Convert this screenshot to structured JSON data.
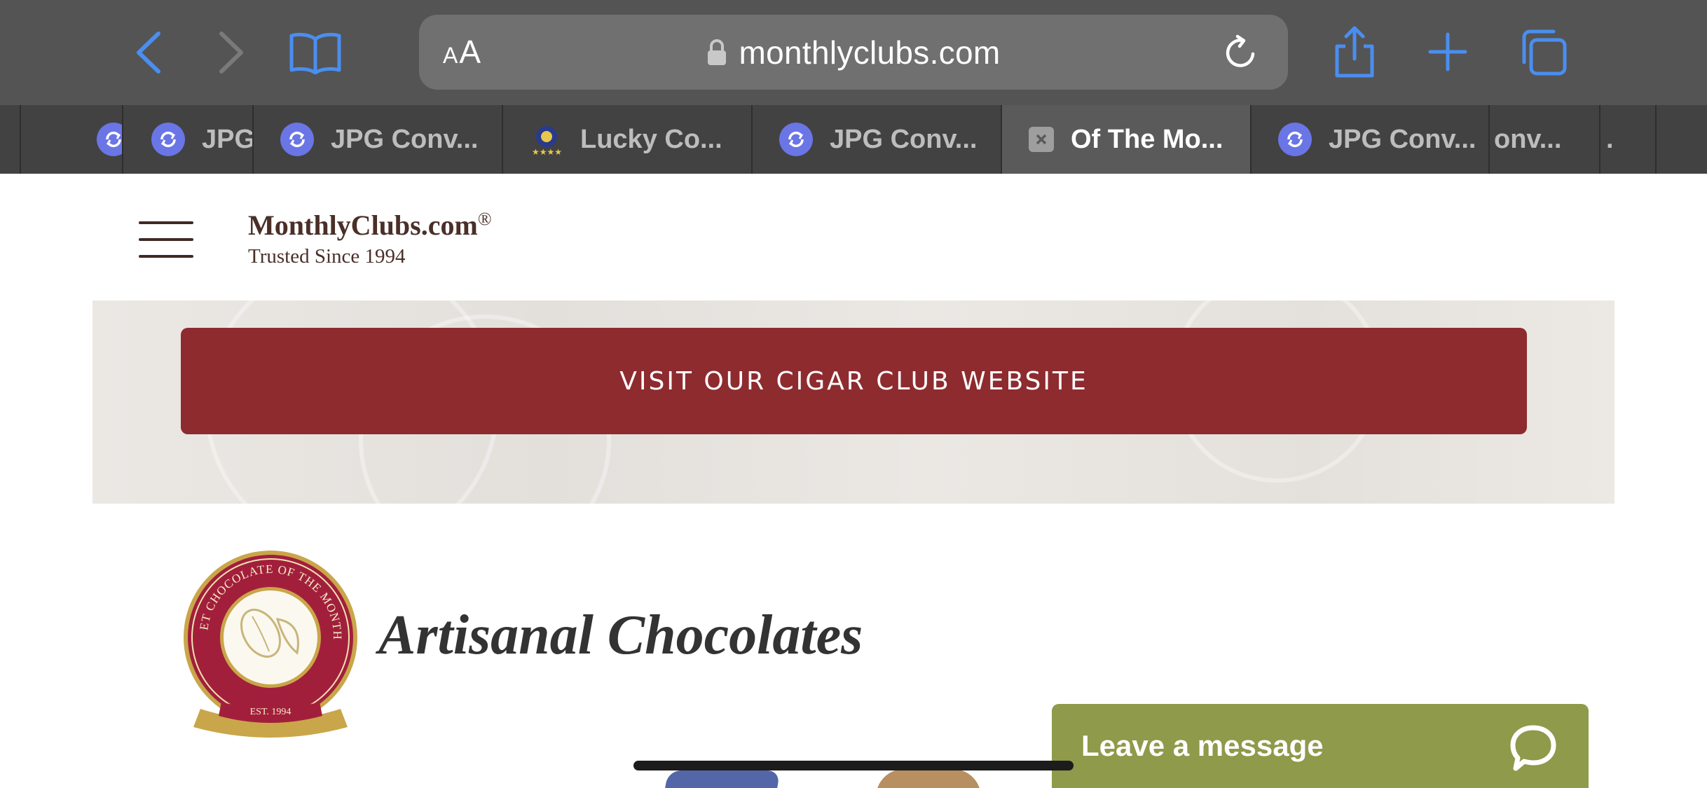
{
  "browser": {
    "url": "monthlyclubs.com",
    "aa_small": "A",
    "aa_big": "A",
    "tabs": [
      {
        "title": ""
      },
      {
        "title": "JPG"
      },
      {
        "title": "JPG Conv..."
      },
      {
        "title": "Lucky Co..."
      },
      {
        "title": "JPG Conv..."
      },
      {
        "title": "Of The Mo..."
      },
      {
        "title": "JPG Conv..."
      },
      {
        "title": "onv..."
      },
      {
        "title": "."
      }
    ],
    "icons": {
      "back": "chevron-left-icon",
      "forward": "chevron-right-icon",
      "bookmarks": "book-icon",
      "lock": "lock-icon",
      "reload": "reload-icon",
      "share": "share-icon",
      "new_tab": "plus-icon",
      "tabs": "tabs-icon"
    },
    "accent_color": "#4a8ef0"
  },
  "site": {
    "logo_title": "MonthlyClubs.com",
    "logo_reg": "®",
    "logo_tagline": "Trusted Since 1994",
    "cta_label": "VISIT OUR CIGAR CLUB WEBSITE",
    "cta_color": "#8e2b2f",
    "badge_text_top": "GOURMET CHOCOLATE OF THE MONTH CLUB",
    "badge_est": "EST. 1994",
    "club_title": "Artisanal Chocolates"
  },
  "chat": {
    "label": "Leave a message",
    "color": "#8f9a4a"
  }
}
